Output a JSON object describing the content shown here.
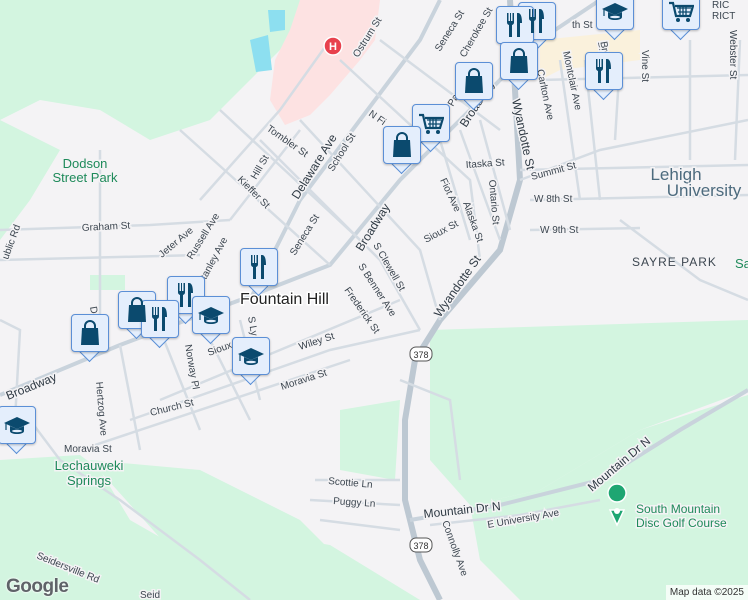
{
  "places": {
    "town": "Fountain Hill",
    "university": [
      "Lehigh",
      "University"
    ],
    "area_sayre": "SAYRE PARK",
    "area_sayre_cut": "Sa",
    "district": [
      "RIC",
      "RICT"
    ],
    "park_dodson": [
      "Dodson",
      "Street Park"
    ],
    "park_lechauweki": [
      "Lechauweki",
      "Springs"
    ],
    "poi_disc_golf": [
      "South Mountain",
      "Disc Golf Course"
    ]
  },
  "streets": {
    "ostrum": "Ostrum St",
    "seneca_n": "Seneca St",
    "cherokee": "Cherokee St",
    "broadway_n": "Broadway",
    "broadway_c": "Broadway",
    "broadway_w": "Broadway",
    "wyandotte_n": "Wyandotte St",
    "wyandotte_s": "Wyandotte St",
    "carlton": "Carlton Ave",
    "montclair": "Montclair Ave",
    "vine": "Vine St",
    "webster": "Webster St",
    "n_fillmore": "N Fi",
    "tombler": "Tombler St",
    "delaware": "Delaware Ave",
    "school": "School St",
    "hill": "Hill St",
    "kieffer": "Kieffer St",
    "itaska": "Itaska St",
    "summit": "Summit St",
    "fiot": "Fiot Ave",
    "alaska": "Alaska St",
    "ontario": "Ontario St",
    "w8th": "W 8th St",
    "w9th": "W 9th St",
    "sioux_e": "Sioux St",
    "graham": "Graham St",
    "jeter": "Jeter Ave",
    "russell": "Russell Ave",
    "stanley": "tanley Ave",
    "seneca_s": "Seneca St",
    "s_clewell": "S Clewell St",
    "s_benner": "S Benner Ave",
    "frederick": "Frederick St",
    "public": "ublic Rd",
    "wiley": "Wiley St",
    "moravia": "Moravia St",
    "moravia_w": "Moravia St",
    "church": "Church St",
    "norway": "Norway Pl",
    "hertzog": "Hertzog Ave",
    "sioux_w": "Sioux",
    "s_ly": "S Ly",
    "d_st": "D",
    "scottie": "Scottie Ln",
    "puggy": "Puggy Ln",
    "mountain_dr": "Mountain Dr N",
    "mountain_dr2": "Mountain Dr N",
    "e_university": "E University Ave",
    "connolly": "Connolly Ave",
    "seidersville": "Seidersville Rd",
    "seid_cut": "Seid",
    "th_st": "th St",
    "bi": "Bi",
    "bro": "Bro",
    "pa": "Pa",
    "route": "378",
    "route2": "378"
  },
  "markers": [
    {
      "type": "restaurant"
    },
    {
      "type": "shopping"
    },
    {
      "type": "restaurant"
    },
    {
      "type": "restaurant"
    },
    {
      "type": "school"
    },
    {
      "type": "shopping"
    },
    {
      "type": "school"
    },
    {
      "type": "school"
    },
    {
      "type": "shopping"
    },
    {
      "type": "grocery"
    },
    {
      "type": "shopping"
    },
    {
      "type": "shopping"
    },
    {
      "type": "restaurant"
    },
    {
      "type": "restaurant"
    },
    {
      "type": "restaurant"
    },
    {
      "type": "school"
    },
    {
      "type": "grocery"
    },
    {
      "type": "hospital"
    }
  ],
  "footer": {
    "logo": "Google",
    "attribution": "Map data ©2025"
  },
  "colors": {
    "background": "#f4f3f5",
    "park": "#d3f5e0",
    "hospital_area": "#fde2e2",
    "water": "#8ddff0",
    "marker_icon": "#0b4a6e",
    "marker_bg": "#e4eefc",
    "marker_border": "#5b8fd6",
    "hospital": "#e8414d"
  }
}
